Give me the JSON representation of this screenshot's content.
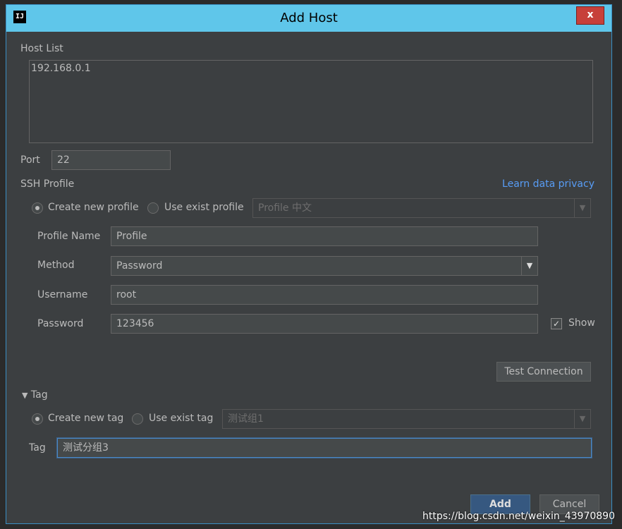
{
  "window": {
    "title": "Add Host",
    "app_icon": "IJ",
    "close_glyph": "x"
  },
  "host_list": {
    "label": "Host List",
    "items": [
      "192.168.0.1"
    ]
  },
  "port": {
    "label": "Port",
    "value": "22"
  },
  "ssh_profile": {
    "label": "SSH Profile",
    "privacy_link": "Learn data privacy",
    "create_new_label": "Create new profile",
    "use_exist_label": "Use exist profile",
    "exist_profile_value": "Profile 中文",
    "profile_name_label": "Profile Name",
    "profile_name_value": "Profile",
    "method_label": "Method",
    "method_value": "Password",
    "username_label": "Username",
    "username_value": "root",
    "password_label": "Password",
    "password_value": "123456",
    "show_label": "Show",
    "show_checked": true,
    "test_connection_label": "Test Connection"
  },
  "tag_section": {
    "header": "Tag",
    "create_new_label": "Create new tag",
    "use_exist_label": "Use exist tag",
    "exist_tag_value": "测试组1",
    "tag_label": "Tag",
    "tag_value": "测试分组3"
  },
  "footer": {
    "add_label": "Add",
    "cancel_label": "Cancel"
  },
  "watermark": "https://blog.csdn.net/weixin_43970890",
  "colors": {
    "titlebar": "#5fc6ea",
    "background": "#3c3f41",
    "primary_button": "#365880",
    "link": "#589df6"
  }
}
